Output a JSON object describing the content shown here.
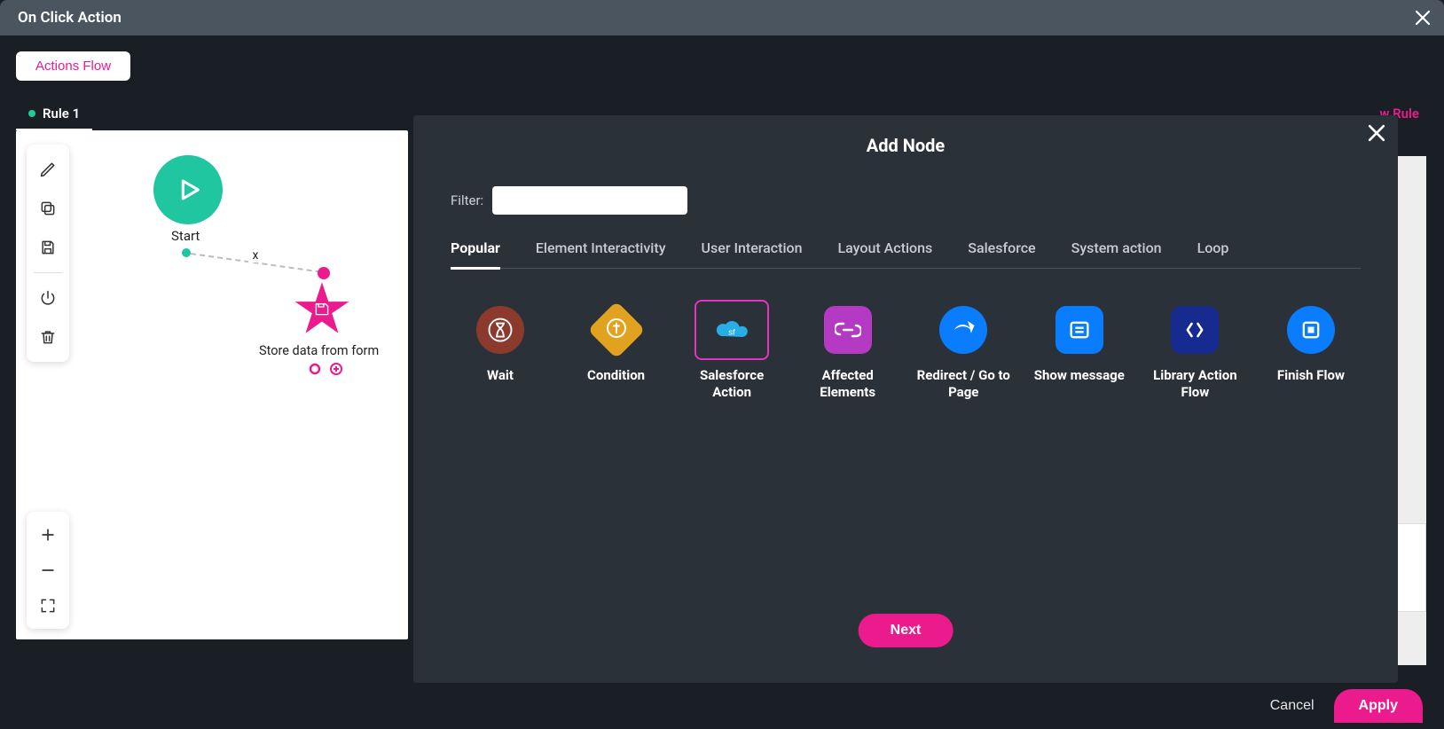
{
  "header": {
    "title": "On Click Action"
  },
  "toolbar": {
    "actions_flow_btn": "Actions Flow",
    "rule_tab": "Rule 1",
    "add_rule_link": "w Rule"
  },
  "canvas": {
    "start_label": "Start",
    "store_label": "Store data from form",
    "dash_x": "x"
  },
  "modal": {
    "title": "Add Node",
    "filter_label": "Filter:",
    "filter_value": "",
    "categories": [
      {
        "label": "Popular",
        "active": true
      },
      {
        "label": "Element Interactivity",
        "active": false
      },
      {
        "label": "User Interaction",
        "active": false
      },
      {
        "label": "Layout Actions",
        "active": false
      },
      {
        "label": "Salesforce",
        "active": false
      },
      {
        "label": "System action",
        "active": false
      },
      {
        "label": "Loop",
        "active": false
      }
    ],
    "nodes": [
      {
        "id": "wait",
        "label": "Wait",
        "color": "#8d3a2e",
        "shape": "circle",
        "selected": false
      },
      {
        "id": "condition",
        "label": "Condition",
        "color": "#e0a21f",
        "shape": "diamond",
        "selected": false
      },
      {
        "id": "salesforce-action",
        "label": "Salesforce Action",
        "color": "#27aee6",
        "shape": "cloud",
        "selected": true
      },
      {
        "id": "affected-elements",
        "label": "Affected Elements",
        "color": "#b43ac4",
        "shape": "rounded",
        "selected": false
      },
      {
        "id": "redirect",
        "label": "Redirect / Go to Page",
        "color": "#0a7dff",
        "shape": "circle",
        "selected": false
      },
      {
        "id": "show-message",
        "label": "Show message",
        "color": "#0a7dff",
        "shape": "rounded",
        "selected": false
      },
      {
        "id": "library-action-flow",
        "label": "Library Action Flow",
        "color": "#162a90",
        "shape": "rounded",
        "selected": false
      },
      {
        "id": "finish-flow",
        "label": "Finish Flow",
        "color": "#0a7dff",
        "shape": "circle",
        "selected": false
      }
    ],
    "next_btn": "Next"
  },
  "footer": {
    "cancel": "Cancel",
    "apply": "Apply"
  }
}
